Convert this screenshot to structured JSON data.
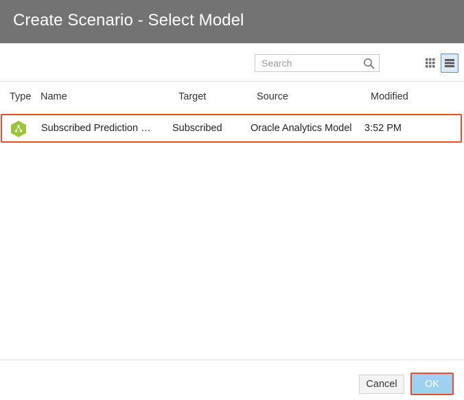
{
  "dialog": {
    "title": "Create Scenario - Select Model"
  },
  "toolbar": {
    "search_placeholder": "Search",
    "search_value": "",
    "view_modes": [
      "grid-view-icon",
      "list-view-icon"
    ],
    "active_view": "list"
  },
  "table": {
    "columns": [
      "Type",
      "Name",
      "Target",
      "Source",
      "Modified"
    ],
    "rows": [
      {
        "type_icon": "model-icon",
        "name": "Subscribed Prediction …",
        "target": "Subscribed",
        "source": "Oracle Analytics Model",
        "modified": "3:52 PM",
        "selected": true
      }
    ]
  },
  "footer": {
    "cancel_label": "Cancel",
    "ok_label": "OK"
  },
  "colors": {
    "title_bar": "#737373",
    "highlight": "#e0502f",
    "ok_button": "#9ed0f0",
    "model_icon": "#9cc43c"
  }
}
